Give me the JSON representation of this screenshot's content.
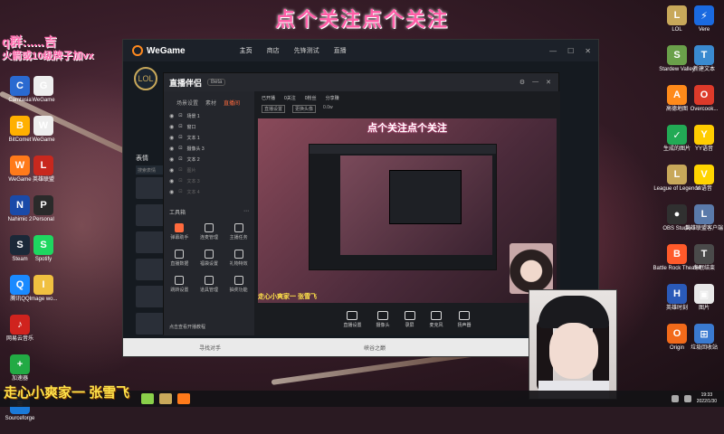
{
  "stream": {
    "top_banner": "点个关注点个关注",
    "left_overlay_line1": "q群:.....吉",
    "left_overlay_line2": "火箭或10级牌子加vx",
    "streamer_name": "走心小爽家一 张雪飞"
  },
  "desktop_left": [
    {
      "label": "Camtasia",
      "color": "#2a6ad0",
      "glyph": "C"
    },
    {
      "label": "BitComet",
      "color": "#ffb000",
      "glyph": "B"
    },
    {
      "label": "WeGame",
      "color": "#ff7a1a",
      "glyph": "W"
    },
    {
      "label": "Nahimic 2",
      "color": "#1a4aa8",
      "glyph": "N"
    },
    {
      "label": "Steam",
      "color": "#1b2838",
      "glyph": "S"
    },
    {
      "label": "腾讯QQ",
      "color": "#1a8aff",
      "glyph": "Q"
    },
    {
      "label": "网易云音乐",
      "color": "#d0231e",
      "glyph": "♪"
    },
    {
      "label": "加速器",
      "color": "#22aa44",
      "glyph": "+"
    },
    {
      "label": "Sourceforge",
      "color": "#1a7ad8",
      "glyph": "≡"
    }
  ],
  "desktop_left2": [
    {
      "label": "WeGame",
      "color": "#eeeeee",
      "glyph": "G"
    },
    {
      "label": "WeGame",
      "color": "#eeeeee",
      "glyph": "W"
    },
    {
      "label": "英雄联盟",
      "color": "#c8281e",
      "glyph": "L"
    },
    {
      "label": "Personal",
      "color": "#2a2a2a",
      "glyph": "P"
    },
    {
      "label": "Spotify",
      "color": "#1ed760",
      "glyph": "S"
    },
    {
      "label": "Image wo...",
      "color": "#f0c040",
      "glyph": "I"
    }
  ],
  "desktop_right1": [
    {
      "label": "LOL",
      "color": "#c8a85a",
      "glyph": "L"
    },
    {
      "label": "Stardew Valley",
      "color": "#6aa04a",
      "glyph": "S"
    },
    {
      "label": "高德地图",
      "color": "#ff8a1a",
      "glyph": "A"
    },
    {
      "label": "生成的图片",
      "color": "#22aa55",
      "glyph": "✓"
    },
    {
      "label": "League of Legends",
      "color": "#c8a85a",
      "glyph": "L"
    },
    {
      "label": "OBS Studio",
      "color": "#303030",
      "glyph": "●"
    },
    {
      "label": "Battle Rock Theater",
      "color": "#ff5a2a",
      "glyph": "B"
    },
    {
      "label": "英雄时刻",
      "color": "#2a5ab8",
      "glyph": "H"
    },
    {
      "label": "Origin",
      "color": "#f26a1a",
      "glyph": "O"
    }
  ],
  "desktop_right2": [
    {
      "label": "Vere",
      "color": "#1a6ae0",
      "glyph": "⚡"
    },
    {
      "label": "新建文本",
      "color": "#3a8ad0",
      "glyph": "T"
    },
    {
      "label": "Overcook...",
      "color": "#dd3a2a",
      "glyph": "O"
    },
    {
      "label": "YY语音",
      "color": "#ffcc00",
      "glyph": "Y"
    },
    {
      "label": "VI语音",
      "color": "#ffd400",
      "glyph": "V"
    },
    {
      "label": "英雄联盟客户端",
      "color": "#5a7aaa",
      "glyph": "L"
    },
    {
      "label": "冬眠结束",
      "color": "#4a4a4a",
      "glyph": "T"
    },
    {
      "label": "图片",
      "color": "#e8e8e8",
      "glyph": "▣"
    },
    {
      "label": "垃圾回收站",
      "color": "#3a7ad0",
      "glyph": "⊞"
    }
  ],
  "wegame": {
    "logo": "WeGame",
    "nav": [
      "主页",
      "商店",
      "先锋测试",
      "直播"
    ],
    "lol_label": "LOL",
    "table_label": "表情",
    "search_placeholder": "搜索表情",
    "status": "寻找对手",
    "rank": "峡谷之巅"
  },
  "zhibo": {
    "logo": "直播伴侣",
    "version": "Beta",
    "tabs": [
      "场景设置",
      "素材",
      "直播间"
    ],
    "scenes": [
      {
        "name": "场景 1",
        "dim": false
      },
      {
        "name": "窗口",
        "dim": false
      },
      {
        "name": "文本 1",
        "dim": false
      },
      {
        "name": "摄像头 3",
        "dim": false
      },
      {
        "name": "文本 2",
        "dim": false
      },
      {
        "name": "图片",
        "dim": true
      },
      {
        "name": "文本 3",
        "dim": true
      },
      {
        "name": "文本 4",
        "dim": true
      }
    ],
    "tools_title": "工具箱",
    "tools": [
      "弹幕助手",
      "连麦管理",
      "主播任务",
      "直播数据",
      "福袋设置",
      "礼物特效",
      "跳转设置",
      "道具管理",
      "抽奖功能"
    ],
    "info_items": [
      "已开播",
      "0关注",
      "0粉丝",
      "分享赚"
    ],
    "info_row2": [
      "直播设置",
      "更换头像",
      "0.0w"
    ],
    "bottom_tip": "点击查看开播教程",
    "preview_title": "点个关注点个关注",
    "preview_name": "走心小爽家一 张雪飞",
    "controls": [
      "直播设置",
      "摄像头",
      "录屏",
      "麦克风",
      "扬声器"
    ]
  },
  "clock": {
    "time": "19:33",
    "date": "2022/1/30"
  }
}
